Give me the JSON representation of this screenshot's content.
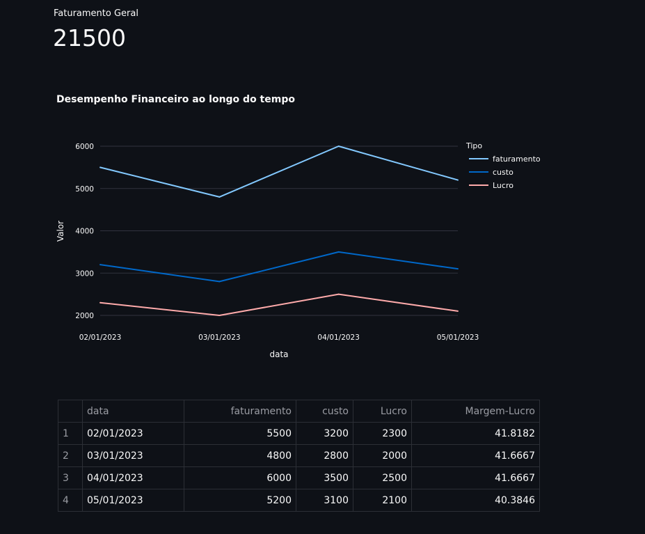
{
  "metric": {
    "label": "Faturamento Geral",
    "value": "21500"
  },
  "chart_data": {
    "type": "line",
    "title": "Desempenho Financeiro ao longo do tempo",
    "xlabel": "data",
    "ylabel": "Valor",
    "categories": [
      "02/01/2023",
      "03/01/2023",
      "04/01/2023",
      "05/01/2023"
    ],
    "yticks": [
      2000,
      3000,
      4000,
      5000,
      6000
    ],
    "ylim": [
      1800,
      6200
    ],
    "grid": true,
    "legend_title": "Tipo",
    "legend_position": "right",
    "series": [
      {
        "name": "faturamento",
        "values": [
          5500,
          4800,
          6000,
          5200
        ],
        "color": "#83c9ff"
      },
      {
        "name": "custo",
        "values": [
          3200,
          2800,
          3500,
          3100
        ],
        "color": "#0068c9"
      },
      {
        "name": "Lucro",
        "values": [
          2300,
          2000,
          2500,
          2100
        ],
        "color": "#ffabab"
      }
    ]
  },
  "table": {
    "columns": [
      "",
      "data",
      "faturamento",
      "custo",
      "Lucro",
      "Margem-Lucro"
    ],
    "rows": [
      [
        "1",
        "02/01/2023",
        "5500",
        "3200",
        "2300",
        "41.8182"
      ],
      [
        "2",
        "03/01/2023",
        "4800",
        "2800",
        "2000",
        "41.6667"
      ],
      [
        "3",
        "04/01/2023",
        "6000",
        "3500",
        "2500",
        "41.6667"
      ],
      [
        "4",
        "05/01/2023",
        "5200",
        "3100",
        "2100",
        "40.3846"
      ]
    ]
  }
}
